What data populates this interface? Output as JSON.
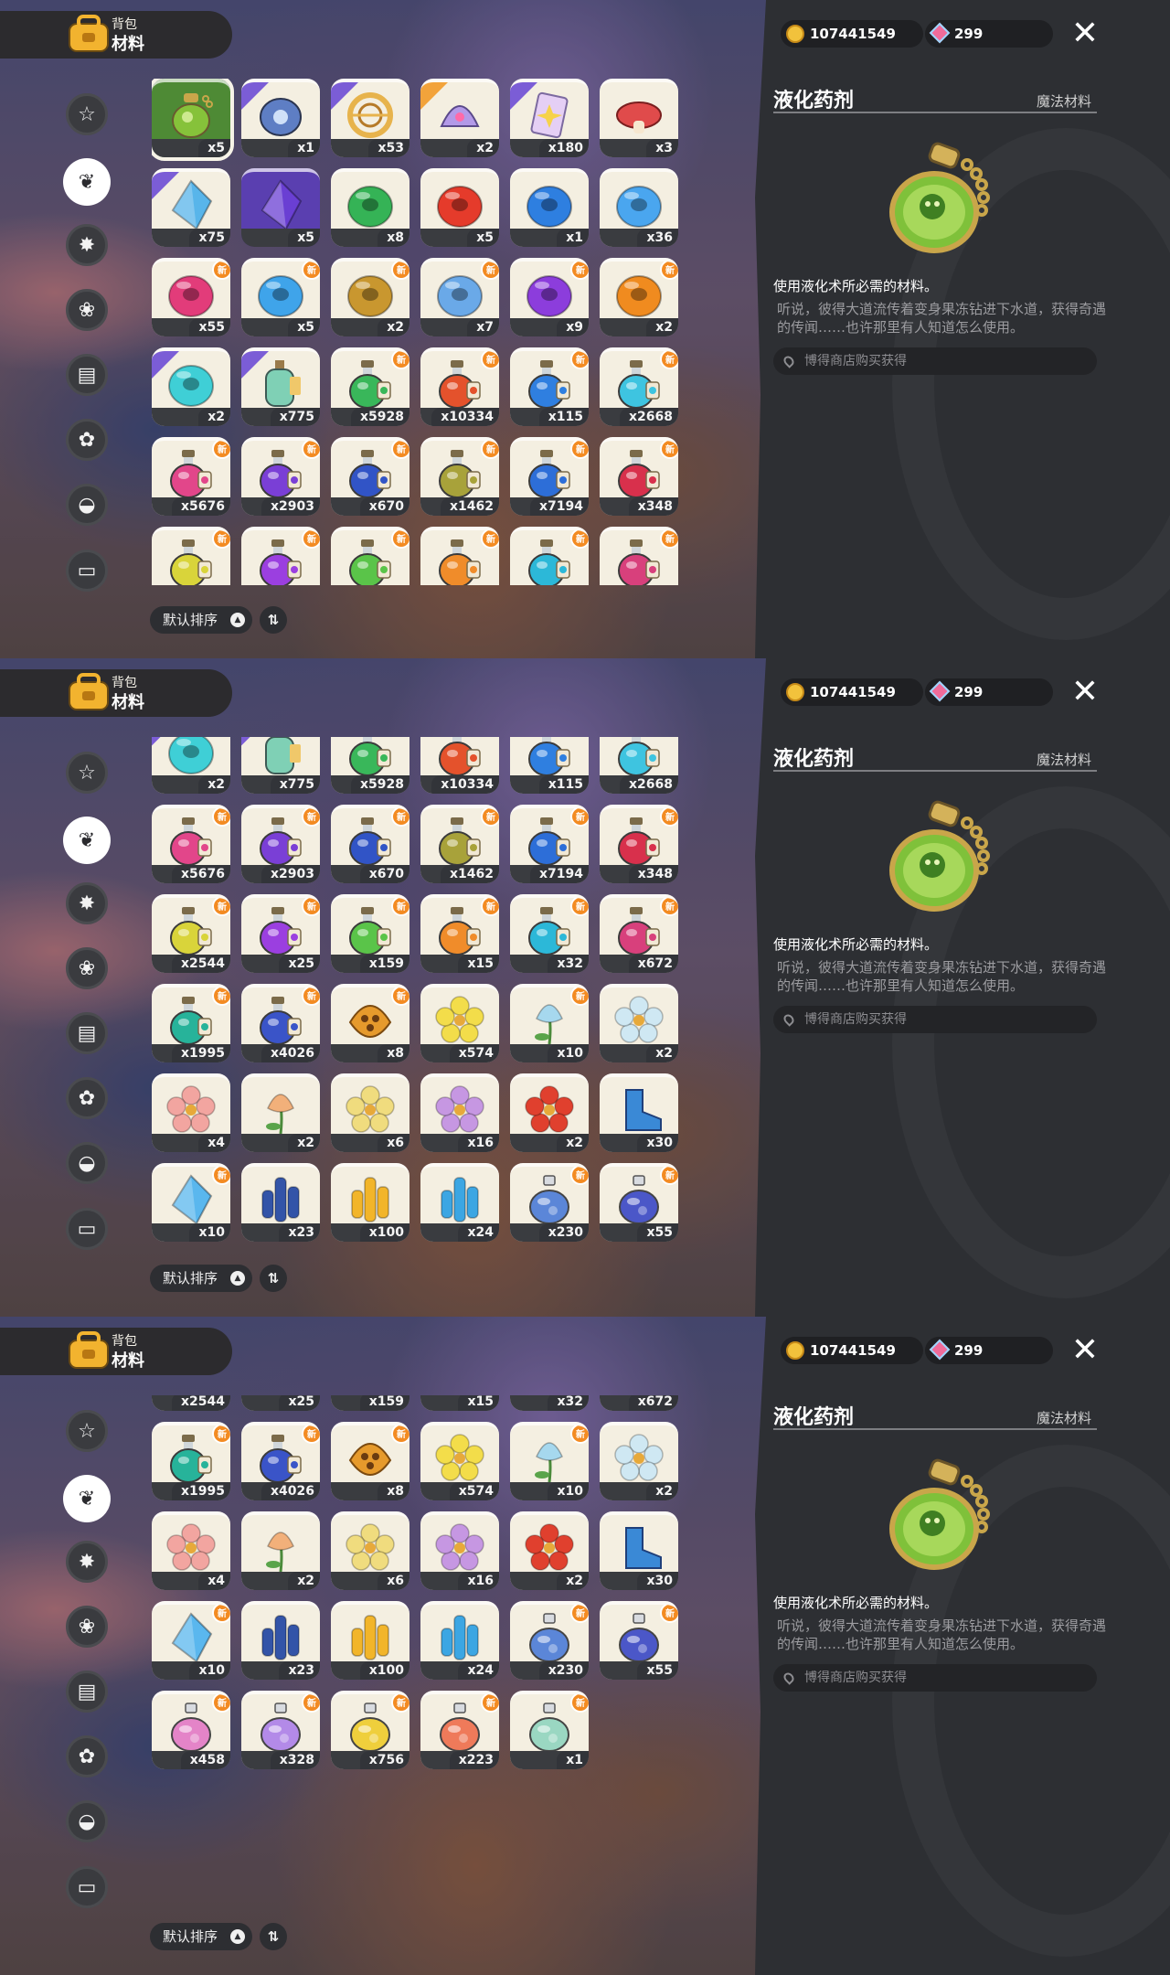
{
  "header": {
    "bag_label": "背包",
    "category_title": "材料"
  },
  "currency": {
    "coins": "107441549",
    "gems": "299"
  },
  "sort": {
    "label": "默认排序"
  },
  "categories": [
    "star-icon",
    "leaf-icon",
    "sparkle-icon",
    "bud-icon",
    "book-icon",
    "flower-icon",
    "acorn-icon",
    "sofa-icon"
  ],
  "detail": {
    "name": "液化药剂",
    "type": "魔法材料",
    "description": "使用液化术所必需的材料。",
    "flavor": "听说，彼得大道流传着变身果冻钻进下水道，获得奇遇的传闻……也许那里有人知道怎么使用。",
    "source": "博得商店购买获得"
  },
  "items": [
    {
      "name": "liquefy-potion",
      "count": "x5",
      "color": "#86c23a",
      "shape": "potion",
      "bg": "#4e8a35",
      "sel": true
    },
    {
      "name": "blue-stone",
      "count": "x1",
      "color": "#5e7ec4",
      "shape": "stone",
      "rib": "#7b5dd6"
    },
    {
      "name": "gold-ring",
      "count": "x53",
      "color": "#e7b34c",
      "shape": "ring",
      "rib": "#7b5dd6"
    },
    {
      "name": "horn-shell",
      "count": "x2",
      "color": "#b39ae8",
      "shape": "shell",
      "rib": "#f2a33b"
    },
    {
      "name": "star-card",
      "count": "x180",
      "color": "#e5cff5",
      "shape": "card",
      "rib": "#7b5dd6"
    },
    {
      "name": "red-mushroom",
      "count": "x3",
      "color": "#e04b4b",
      "shape": "mush"
    },
    {
      "name": "ice-crystal",
      "count": "x75",
      "color": "#58b5ea",
      "shape": "crystal",
      "rib": "#7b5dd6"
    },
    {
      "name": "purple-crystal",
      "count": "x5",
      "color": "#6a3fd3",
      "shape": "crystal",
      "bg": "#5a3fb0"
    },
    {
      "name": "green-donut",
      "count": "x8",
      "color": "#35b356",
      "shape": "donut"
    },
    {
      "name": "red-donut",
      "count": "x5",
      "color": "#e53b2b",
      "shape": "donut"
    },
    {
      "name": "blue-donut",
      "count": "x1",
      "color": "#2e7fe0",
      "shape": "donut"
    },
    {
      "name": "sky-donut",
      "count": "x36",
      "color": "#4aa6ef",
      "shape": "donut"
    },
    {
      "name": "pink-donut",
      "count": "x55",
      "color": "#e23c7a",
      "shape": "donut",
      "new": true
    },
    {
      "name": "cyan-donut",
      "count": "x5",
      "color": "#3fa4ea",
      "shape": "donut",
      "new": true
    },
    {
      "name": "gold-donut",
      "count": "x2",
      "color": "#c9972f",
      "shape": "donut",
      "new": true
    },
    {
      "name": "light-blue-donut",
      "count": "x7",
      "color": "#6aa9e8",
      "shape": "donut",
      "new": true
    },
    {
      "name": "violet-donut",
      "count": "x9",
      "color": "#8c3ddc",
      "shape": "donut",
      "new": true
    },
    {
      "name": "orange-donut",
      "count": "x2",
      "color": "#f08b1f",
      "shape": "donut",
      "new": true
    },
    {
      "name": "teal-donut",
      "count": "x2",
      "color": "#3fcfd6",
      "shape": "donut",
      "rib": "#7b5dd6"
    },
    {
      "name": "tag-bottle",
      "count": "x775",
      "color": "#7fd0b5",
      "shape": "bottle",
      "rib": "#7b5dd6"
    },
    {
      "name": "green-flask",
      "count": "x5928",
      "color": "#39b75a",
      "shape": "flask",
      "new": true
    },
    {
      "name": "red-flask",
      "count": "x10334",
      "color": "#e4522c",
      "shape": "flask",
      "new": true
    },
    {
      "name": "blue-flask",
      "count": "x115",
      "color": "#2f7fe0",
      "shape": "flask",
      "new": true
    },
    {
      "name": "aqua-flask",
      "count": "x2668",
      "color": "#3ec4e0",
      "shape": "flask",
      "new": true
    },
    {
      "name": "pink-flask",
      "count": "x5676",
      "color": "#e2468a",
      "shape": "flask",
      "new": true
    },
    {
      "name": "purple-flask",
      "count": "x2903",
      "color": "#7a3fd6",
      "shape": "flask",
      "new": true
    },
    {
      "name": "navy-flask",
      "count": "x670",
      "color": "#3154c6",
      "shape": "flask",
      "new": true
    },
    {
      "name": "olive-flask",
      "count": "x1462",
      "color": "#a8a23a",
      "shape": "flask",
      "new": true
    },
    {
      "name": "deep-blue-flask",
      "count": "x7194",
      "color": "#2d6ed8",
      "shape": "flask",
      "new": true
    },
    {
      "name": "crimson-flask",
      "count": "x348",
      "color": "#d8304c",
      "shape": "flask",
      "new": true
    },
    {
      "name": "yellow-flask",
      "count": "x2544",
      "color": "#d9d43a",
      "shape": "flask",
      "new": true
    },
    {
      "name": "violet-flask",
      "count": "x25",
      "color": "#9b3fe0",
      "shape": "flask",
      "new": true
    },
    {
      "name": "lime-flask",
      "count": "x159",
      "color": "#5ac449",
      "shape": "flask",
      "new": true
    },
    {
      "name": "orange-flask",
      "count": "x15",
      "color": "#f08c2a",
      "shape": "flask",
      "new": true
    },
    {
      "name": "cyan-flask",
      "count": "x32",
      "color": "#2cb8d8",
      "shape": "flask",
      "new": true
    },
    {
      "name": "magenta-flask",
      "count": "x672",
      "color": "#d8407c",
      "shape": "flask",
      "new": true
    },
    {
      "name": "teal-flask",
      "count": "x1995",
      "color": "#27b39a",
      "shape": "flask",
      "new": true
    },
    {
      "name": "indigo-flask",
      "count": "x4026",
      "color": "#3a54c8",
      "shape": "flask",
      "new": true
    },
    {
      "name": "honeycomb",
      "count": "x8",
      "color": "#e69a2c",
      "shape": "comb",
      "new": true
    },
    {
      "name": "yellow-flower",
      "count": "x574",
      "color": "#f3dd4a",
      "shape": "flower"
    },
    {
      "name": "bell-flower",
      "count": "x10",
      "color": "#a6d8ee",
      "shape": "bell",
      "new": true
    },
    {
      "name": "white-lily",
      "count": "x2",
      "color": "#cfe8f3",
      "shape": "flower"
    },
    {
      "name": "pink-rose",
      "count": "x4",
      "color": "#f2a5a0",
      "shape": "flower"
    },
    {
      "name": "trumpet-flower",
      "count": "x2",
      "color": "#f2b07a",
      "shape": "bell"
    },
    {
      "name": "star-lily",
      "count": "x6",
      "color": "#f0dc7e",
      "shape": "flower"
    },
    {
      "name": "purple-blossom",
      "count": "x16",
      "color": "#c697e2",
      "shape": "flower"
    },
    {
      "name": "red-blossom",
      "count": "x2",
      "color": "#e0402e",
      "shape": "flower"
    },
    {
      "name": "blue-boot",
      "count": "x30",
      "color": "#3a89d6",
      "shape": "boot"
    },
    {
      "name": "ice-shard",
      "count": "x10",
      "color": "#5ab7ee",
      "shape": "crystal",
      "new": true
    },
    {
      "name": "blue-coral",
      "count": "x23",
      "color": "#3354a8",
      "shape": "coral"
    },
    {
      "name": "amber-crystal",
      "count": "x100",
      "color": "#f2b52a",
      "shape": "coral"
    },
    {
      "name": "aqua-crystal",
      "count": "x24",
      "color": "#3ca6e3",
      "shape": "coral"
    },
    {
      "name": "star-potion",
      "count": "x230",
      "color": "#5b86d8",
      "shape": "round",
      "new": true
    },
    {
      "name": "indigo-potion",
      "count": "x55",
      "color": "#4b57c8",
      "shape": "round",
      "new": true
    },
    {
      "name": "pink-potion",
      "count": "x458",
      "color": "#e484c8",
      "shape": "round",
      "new": true
    },
    {
      "name": "lavender-potion",
      "count": "x328",
      "color": "#b38ae8",
      "shape": "round",
      "new": true
    },
    {
      "name": "yellow-potion",
      "count": "x756",
      "color": "#efcf3c",
      "shape": "round",
      "new": true
    },
    {
      "name": "coral-potion",
      "count": "x223",
      "color": "#ef7a5a",
      "shape": "round",
      "new": true
    },
    {
      "name": "rainbow-potion",
      "count": "x1",
      "color": "#9ad7c2",
      "shape": "round",
      "new": true
    }
  ],
  "views": [
    {
      "label": "top",
      "scroll_rows": 0
    },
    {
      "label": "middle",
      "scroll_rows": 3.25
    },
    {
      "label": "bottom",
      "scroll_rows": 5.7
    }
  ]
}
